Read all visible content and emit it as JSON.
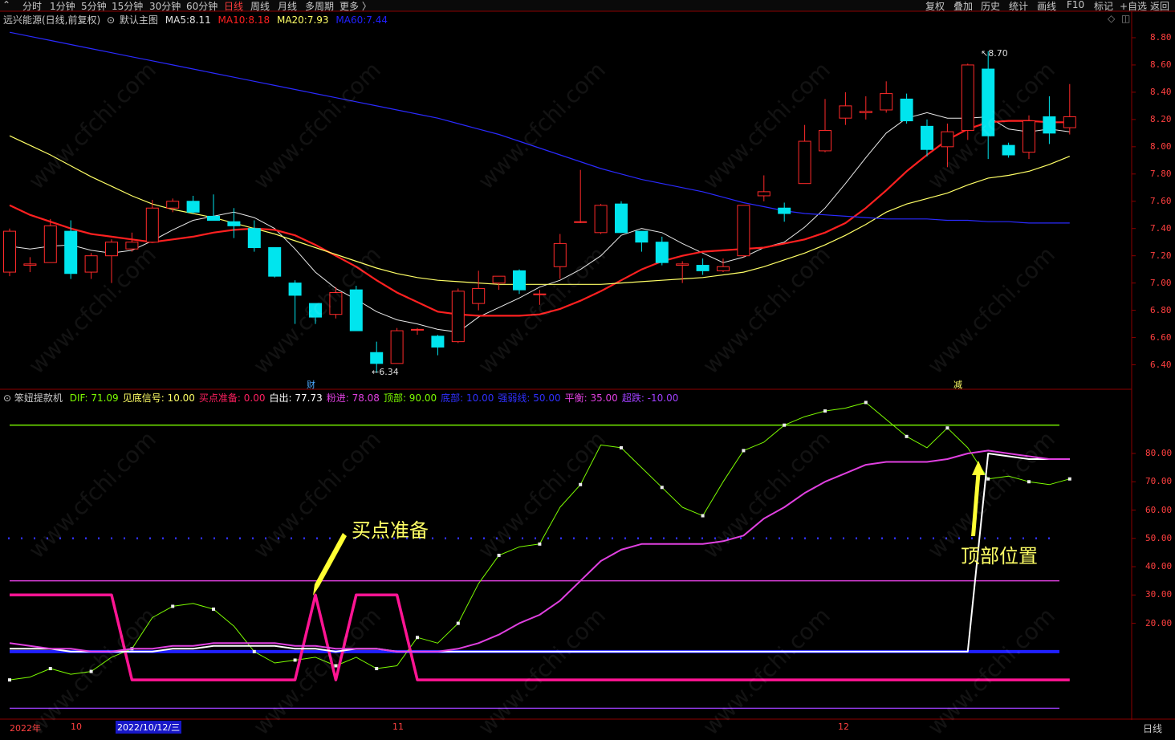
{
  "toolbar": {
    "left_tabs": [
      "分时",
      "1分钟",
      "5分钟",
      "15分钟",
      "30分钟",
      "60分钟",
      "日线",
      "周线",
      "月线",
      "多周期",
      "更多 〉"
    ],
    "active_tab": "日线",
    "right_buttons": [
      "复权",
      "叠加",
      "历史",
      "统计",
      "画线",
      "F10",
      "标记",
      "+自选",
      "返回"
    ]
  },
  "main_panel": {
    "title": "远兴能源(日线,前复权)",
    "indicator_name": "默认主图",
    "ma": [
      {
        "label": "MA5:",
        "value": "8.11",
        "color": "#e0e0e0"
      },
      {
        "label": "MA10:",
        "value": "8.18",
        "color": "#ff2020"
      },
      {
        "label": "MA20:",
        "value": "7.93",
        "color": "#ffff66"
      },
      {
        "label": "MA60:",
        "value": "7.44",
        "color": "#2020ff"
      }
    ],
    "high_label": "8.70",
    "low_label": "6.34",
    "marker_cai": "财",
    "marker_jian": "减"
  },
  "sub_panel": {
    "name": "笨妞提款机",
    "items": [
      {
        "label": "DIF:",
        "value": "71.09",
        "color": "#7cfc00"
      },
      {
        "label": "见底信号:",
        "value": "10.00",
        "color": "#ffff66"
      },
      {
        "label": "买点准备:",
        "value": "0.00",
        "color": "#ff2060"
      },
      {
        "label": "白出:",
        "value": "77.73",
        "color": "#ffffff"
      },
      {
        "label": "粉进:",
        "value": "78.08",
        "color": "#e040e0"
      },
      {
        "label": "顶部:",
        "value": "90.00",
        "color": "#7cfc00"
      },
      {
        "label": "底部:",
        "value": "10.00",
        "color": "#3030ff"
      },
      {
        "label": "强弱线:",
        "value": "50.00",
        "color": "#3030ff"
      },
      {
        "label": "平衡:",
        "value": "35.00",
        "color": "#e040e0"
      },
      {
        "label": "超跌:",
        "value": "-10.00",
        "color": "#a040ff"
      }
    ]
  },
  "annotations": {
    "buy_prep": "买点准备",
    "top_pos": "顶部位置"
  },
  "bottom": {
    "x_labels": [
      "2022年",
      "10",
      "2022/10/12/三",
      "11",
      "12"
    ],
    "period": "日线"
  },
  "watermark": "www.cfchi.com",
  "chart_data": [
    {
      "type": "candlestick",
      "title": "远兴能源(日线,前复权)",
      "ylim": [
        6.25,
        8.9
      ],
      "yticks": [
        "8.80",
        "8.60",
        "8.40",
        "8.20",
        "8.00",
        "7.80",
        "7.60",
        "7.40",
        "7.20",
        "7.00",
        "6.80",
        "6.60",
        "6.40"
      ],
      "candles": [
        {
          "o": 7.08,
          "h": 7.4,
          "l": 7.05,
          "c": 7.38
        },
        {
          "o": 7.13,
          "h": 7.19,
          "l": 7.08,
          "c": 7.14
        },
        {
          "o": 7.15,
          "h": 7.47,
          "l": 7.15,
          "c": 7.42
        },
        {
          "o": 7.38,
          "h": 7.46,
          "l": 7.03,
          "c": 7.07
        },
        {
          "o": 7.08,
          "h": 7.22,
          "l": 7.03,
          "c": 7.2
        },
        {
          "o": 7.2,
          "h": 7.32,
          "l": 7.0,
          "c": 7.3
        },
        {
          "o": 7.25,
          "h": 7.37,
          "l": 7.23,
          "c": 7.3
        },
        {
          "o": 7.3,
          "h": 7.61,
          "l": 7.3,
          "c": 7.55
        },
        {
          "o": 7.55,
          "h": 7.62,
          "l": 7.52,
          "c": 7.6
        },
        {
          "o": 7.6,
          "h": 7.64,
          "l": 7.51,
          "c": 7.52
        },
        {
          "o": 7.49,
          "h": 7.65,
          "l": 7.48,
          "c": 7.46
        },
        {
          "o": 7.45,
          "h": 7.55,
          "l": 7.33,
          "c": 7.42
        },
        {
          "o": 7.4,
          "h": 7.46,
          "l": 7.23,
          "c": 7.26
        },
        {
          "o": 7.26,
          "h": 7.26,
          "l": 7.04,
          "c": 7.05
        },
        {
          "o": 7.0,
          "h": 7.02,
          "l": 6.7,
          "c": 6.91
        },
        {
          "o": 6.85,
          "h": 6.85,
          "l": 6.7,
          "c": 6.75
        },
        {
          "o": 6.77,
          "h": 6.97,
          "l": 6.74,
          "c": 6.93
        },
        {
          "o": 6.95,
          "h": 6.98,
          "l": 6.65,
          "c": 6.65
        },
        {
          "o": 6.49,
          "h": 6.57,
          "l": 6.34,
          "c": 6.41
        },
        {
          "o": 6.41,
          "h": 6.67,
          "l": 6.41,
          "c": 6.65
        },
        {
          "o": 6.66,
          "h": 6.67,
          "l": 6.62,
          "c": 6.66
        },
        {
          "o": 6.61,
          "h": 6.62,
          "l": 6.47,
          "c": 6.53
        },
        {
          "o": 6.57,
          "h": 6.96,
          "l": 6.56,
          "c": 6.94
        },
        {
          "o": 6.85,
          "h": 7.09,
          "l": 6.8,
          "c": 6.96
        },
        {
          "o": 7.0,
          "h": 7.05,
          "l": 6.95,
          "c": 7.05
        },
        {
          "o": 7.09,
          "h": 7.1,
          "l": 6.92,
          "c": 6.95
        },
        {
          "o": 6.92,
          "h": 6.95,
          "l": 6.84,
          "c": 6.92
        },
        {
          "o": 7.12,
          "h": 7.36,
          "l": 7.03,
          "c": 7.29
        },
        {
          "o": 7.45,
          "h": 7.83,
          "l": 7.44,
          "c": 7.45
        },
        {
          "o": 7.37,
          "h": 7.58,
          "l": 7.36,
          "c": 7.57
        },
        {
          "o": 7.58,
          "h": 7.6,
          "l": 7.37,
          "c": 7.37
        },
        {
          "o": 7.38,
          "h": 7.38,
          "l": 7.23,
          "c": 7.3
        },
        {
          "o": 7.3,
          "h": 7.34,
          "l": 7.13,
          "c": 7.15
        },
        {
          "o": 7.13,
          "h": 7.16,
          "l": 7.0,
          "c": 7.14
        },
        {
          "o": 7.13,
          "h": 7.18,
          "l": 7.06,
          "c": 7.09
        },
        {
          "o": 7.09,
          "h": 7.18,
          "l": 7.08,
          "c": 7.12
        },
        {
          "o": 7.2,
          "h": 7.57,
          "l": 7.19,
          "c": 7.57
        },
        {
          "o": 7.64,
          "h": 7.79,
          "l": 7.6,
          "c": 7.67
        },
        {
          "o": 7.55,
          "h": 7.59,
          "l": 7.45,
          "c": 7.51
        },
        {
          "o": 7.73,
          "h": 8.16,
          "l": 7.73,
          "c": 8.04
        },
        {
          "o": 7.97,
          "h": 8.35,
          "l": 7.96,
          "c": 8.12
        },
        {
          "o": 8.21,
          "h": 8.4,
          "l": 8.16,
          "c": 8.3
        },
        {
          "o": 8.25,
          "h": 8.37,
          "l": 8.2,
          "c": 8.26
        },
        {
          "o": 8.27,
          "h": 8.48,
          "l": 8.25,
          "c": 8.39
        },
        {
          "o": 8.35,
          "h": 8.39,
          "l": 8.17,
          "c": 8.19
        },
        {
          "o": 8.15,
          "h": 8.2,
          "l": 7.93,
          "c": 7.98
        },
        {
          "o": 8.0,
          "h": 8.17,
          "l": 7.85,
          "c": 8.11
        },
        {
          "o": 8.12,
          "h": 8.61,
          "l": 8.05,
          "c": 8.6
        },
        {
          "o": 8.57,
          "h": 8.7,
          "l": 7.91,
          "c": 8.08
        },
        {
          "o": 8.01,
          "h": 8.03,
          "l": 7.92,
          "c": 7.94
        },
        {
          "o": 7.96,
          "h": 8.23,
          "l": 7.91,
          "c": 8.19
        },
        {
          "o": 8.22,
          "h": 8.37,
          "l": 8.02,
          "c": 8.1
        },
        {
          "o": 8.14,
          "h": 8.46,
          "l": 8.09,
          "c": 8.22
        }
      ],
      "series": [
        {
          "name": "MA5",
          "values": [
            7.27,
            7.25,
            7.27,
            7.28,
            7.24,
            7.22,
            7.24,
            7.31,
            7.39,
            7.46,
            7.49,
            7.52,
            7.48,
            7.4,
            7.25,
            7.08,
            6.96,
            6.88,
            6.79,
            6.73,
            6.7,
            6.66,
            6.64,
            6.75,
            6.82,
            6.89,
            6.97,
            7.02,
            7.1,
            7.2,
            7.35,
            7.4,
            7.37,
            7.29,
            7.22,
            7.15,
            7.19,
            7.26,
            7.3,
            7.41,
            7.55,
            7.73,
            7.92,
            8.1,
            8.21,
            8.25,
            8.21,
            8.21,
            8.22,
            8.13,
            8.11,
            8.13,
            8.11
          ]
        },
        {
          "name": "MA10",
          "values": [
            7.57,
            7.5,
            7.45,
            7.4,
            7.36,
            7.34,
            7.32,
            7.3,
            7.32,
            7.34,
            7.37,
            7.39,
            7.4,
            7.39,
            7.35,
            7.28,
            7.2,
            7.12,
            7.02,
            6.93,
            6.86,
            6.79,
            6.77,
            6.76,
            6.76,
            6.76,
            6.77,
            6.81,
            6.87,
            6.94,
            7.02,
            7.1,
            7.16,
            7.2,
            7.23,
            7.24,
            7.25,
            7.26,
            7.29,
            7.32,
            7.37,
            7.44,
            7.55,
            7.68,
            7.82,
            7.94,
            8.05,
            8.13,
            8.18,
            8.19,
            8.19,
            8.18,
            8.18
          ]
        },
        {
          "name": "MA20",
          "values": [
            8.08,
            8.01,
            7.94,
            7.86,
            7.78,
            7.71,
            7.64,
            7.58,
            7.54,
            7.51,
            7.48,
            7.44,
            7.4,
            7.36,
            7.31,
            7.26,
            7.21,
            7.16,
            7.11,
            7.07,
            7.04,
            7.02,
            7.01,
            7.0,
            6.99,
            6.99,
            6.99,
            6.99,
            6.99,
            6.99,
            7.0,
            7.01,
            7.02,
            7.03,
            7.04,
            7.06,
            7.08,
            7.12,
            7.17,
            7.22,
            7.28,
            7.35,
            7.43,
            7.52,
            7.58,
            7.62,
            7.66,
            7.72,
            7.77,
            7.79,
            7.82,
            7.87,
            7.93
          ]
        },
        {
          "name": "MA60",
          "values": [
            8.84,
            8.81,
            8.78,
            8.75,
            8.72,
            8.69,
            8.66,
            8.63,
            8.6,
            8.57,
            8.54,
            8.51,
            8.48,
            8.45,
            8.42,
            8.39,
            8.36,
            8.33,
            8.3,
            8.27,
            8.24,
            8.21,
            8.17,
            8.13,
            8.09,
            8.04,
            7.99,
            7.94,
            7.89,
            7.84,
            7.8,
            7.76,
            7.73,
            7.7,
            7.67,
            7.63,
            7.59,
            7.56,
            7.53,
            7.51,
            7.5,
            7.49,
            7.48,
            7.47,
            7.47,
            7.47,
            7.46,
            7.46,
            7.45,
            7.45,
            7.44,
            7.44,
            7.44
          ]
        }
      ]
    },
    {
      "type": "line",
      "title": "笨妞提款机",
      "ylim": [
        -13,
        97
      ],
      "yticks": [
        "80.00",
        "70.00",
        "60.00",
        "50.00",
        "40.00",
        "30.00",
        "20.00"
      ],
      "hlines": [
        {
          "name": "顶部",
          "value": 90,
          "color": "#7cfc00"
        },
        {
          "name": "强弱线",
          "value": 50,
          "color": "#3030ff"
        },
        {
          "name": "平衡",
          "value": 35,
          "color": "#e040e0"
        },
        {
          "name": "底部",
          "value": 10,
          "color": "#2020ff"
        },
        {
          "name": "超跌",
          "value": -10,
          "color": "#a040ff"
        }
      ],
      "series": [
        {
          "name": "DIF",
          "values": [
            0,
            1,
            4,
            2,
            3,
            8,
            11,
            22,
            26,
            27,
            25,
            19,
            10,
            6,
            7,
            8,
            5,
            8,
            4,
            5,
            15,
            13,
            20,
            34,
            44,
            47,
            48,
            61,
            69,
            83,
            82,
            75,
            68,
            61,
            58,
            70,
            81,
            84,
            90,
            93,
            95,
            96,
            98,
            92,
            86,
            82,
            89,
            82,
            71,
            72,
            70,
            69,
            71
          ]
        },
        {
          "name": "买点准备",
          "values": [
            30,
            30,
            30,
            30,
            30,
            30,
            0,
            0,
            0,
            0,
            0,
            0,
            0,
            0,
            0,
            30,
            0,
            30,
            30,
            30,
            0,
            0,
            0,
            0,
            0,
            0,
            0,
            0,
            0,
            0,
            0,
            0,
            0,
            0,
            0,
            0,
            0,
            0,
            0,
            0,
            0,
            0,
            0,
            0,
            0,
            0,
            0,
            0,
            0,
            0,
            0,
            0,
            0
          ]
        },
        {
          "name": "白出",
          "values": [
            11,
            11,
            11,
            10,
            10,
            10,
            10,
            10,
            11,
            11,
            12,
            12,
            12,
            12,
            11,
            11,
            10,
            11,
            11,
            10,
            10,
            10,
            10,
            10,
            10,
            10,
            10,
            10,
            10,
            10,
            10,
            10,
            10,
            10,
            10,
            10,
            10,
            10,
            10,
            10,
            10,
            10,
            10,
            10,
            10,
            10,
            10,
            10,
            80,
            79,
            78,
            78,
            78
          ]
        },
        {
          "name": "粉进",
          "values": [
            13,
            12,
            11,
            11,
            10,
            10,
            11,
            11,
            12,
            12,
            13,
            13,
            13,
            13,
            12,
            12,
            11,
            11,
            11,
            10,
            10,
            10,
            11,
            13,
            16,
            20,
            23,
            28,
            35,
            42,
            46,
            48,
            48,
            48,
            48,
            49,
            51,
            57,
            61,
            66,
            70,
            73,
            76,
            77,
            77,
            77,
            78,
            80,
            81,
            80,
            79,
            78,
            78
          ]
        }
      ]
    }
  ]
}
